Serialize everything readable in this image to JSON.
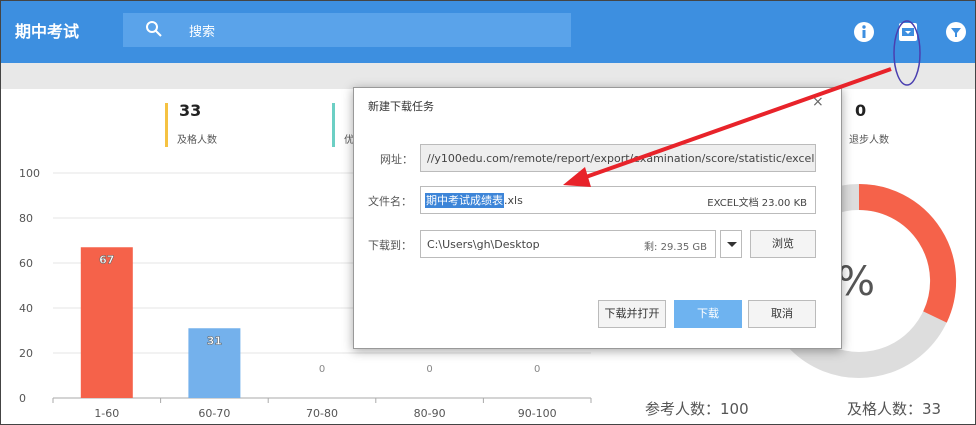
{
  "app": {
    "title": "期中考试"
  },
  "search": {
    "placeholder": "搜索"
  },
  "icons": {
    "search": "search-icon",
    "info": "info-icon",
    "download": "download-box-icon",
    "filter": "filter-funnel-icon",
    "close": "close-icon"
  },
  "stats": [
    {
      "value": "33",
      "label": "及格人数",
      "color": "#f5c242"
    },
    {
      "value": "",
      "label": "优",
      "color": "#6ccfc4"
    },
    {
      "value": "0",
      "label": "退步人数",
      "color": ""
    }
  ],
  "chart_data": {
    "type": "bar",
    "categories": [
      "1-60",
      "60-70",
      "70-80",
      "80-90",
      "90-100"
    ],
    "values": [
      67,
      31,
      0,
      0,
      0
    ],
    "labels": [
      "67",
      "31",
      "0",
      "0",
      "0"
    ],
    "colors": [
      "#f5624a",
      "#74b1ec",
      "#74b1ec",
      "#74b1ec",
      "#74b1ec"
    ],
    "ylim": [
      0,
      100
    ],
    "yticks": [
      0,
      20,
      40,
      60,
      80,
      100
    ],
    "grid": true
  },
  "donut": {
    "percent_symbol": "%",
    "colors": [
      "#f5624a",
      "#dddddd"
    ]
  },
  "bottom": {
    "participants": "参考人数：100",
    "passed": "及格人数：33"
  },
  "dialog": {
    "title": "新建下载任务",
    "close": "×",
    "url_label": "网址：",
    "url_value": "//y100edu.com/remote/report/export/examination/score/statistic/excel",
    "filename_label": "文件名：",
    "filename_selected": "期中考试成绩表",
    "filename_ext": ".xls",
    "filename_meta": "EXCEL文档 23.00 KB",
    "path_label": "下载到：",
    "path_value": "C:\\Users\\gh\\Desktop",
    "path_meta": "剩: 29.35 GB",
    "browse": "浏览",
    "download_open": "下载并打开",
    "download": "下载",
    "cancel": "取消"
  },
  "colors": {
    "topbar": "#3d8fe0",
    "accent": "#e8232a"
  }
}
